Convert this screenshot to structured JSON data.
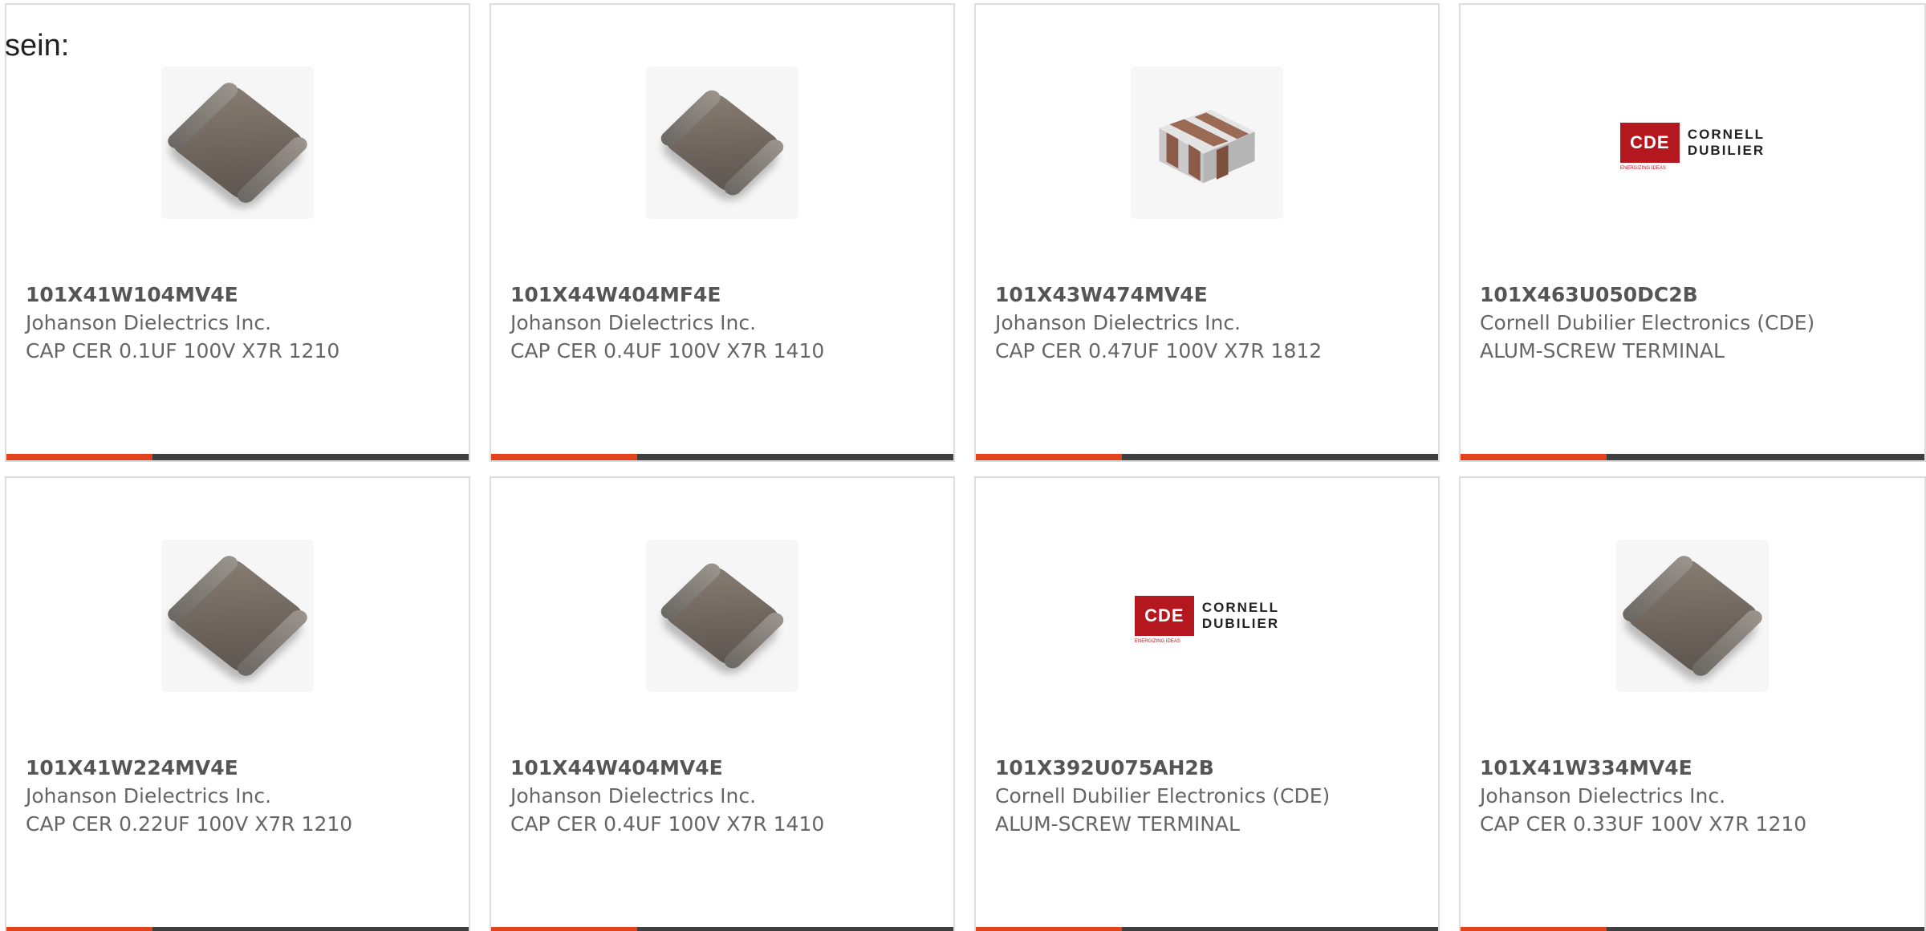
{
  "intro_text": "sein:",
  "products": [
    {
      "part_number": "101X41W104MV4E",
      "manufacturer": "Johanson Dielectrics Inc.",
      "description": "CAP CER 0.1UF 100V X7R 1210",
      "image": "mlcc-chip-image"
    },
    {
      "part_number": "101X44W404MF4E",
      "manufacturer": "Johanson Dielectrics Inc.",
      "description": "CAP CER 0.4UF 100V X7R 1410",
      "image": "mlcc-chip-image"
    },
    {
      "part_number": "101X43W474MV4E",
      "manufacturer": "Johanson Dielectrics Inc.",
      "description": "CAP CER 0.47UF 100V X7R 1812",
      "image": "mlcc-block-image"
    },
    {
      "part_number": "101X463U050DC2B",
      "manufacturer": "Cornell Dubilier Electronics (CDE)",
      "description": "ALUM-SCREW TERMINAL",
      "image": "cde-logo-image"
    },
    {
      "part_number": "101X41W224MV4E",
      "manufacturer": "Johanson Dielectrics Inc.",
      "description": "CAP CER 0.22UF 100V X7R 1210",
      "image": "mlcc-chip-image"
    },
    {
      "part_number": "101X44W404MV4E",
      "manufacturer": "Johanson Dielectrics Inc.",
      "description": "CAP CER 0.4UF 100V X7R 1410",
      "image": "mlcc-chip-image"
    },
    {
      "part_number": "101X392U075AH2B",
      "manufacturer": "Cornell Dubilier Electronics (CDE)",
      "description": "ALUM-SCREW TERMINAL",
      "image": "cde-logo-image"
    },
    {
      "part_number": "101X41W334MV4E",
      "manufacturer": "Johanson Dielectrics Inc.",
      "description": "CAP CER 0.33UF 100V X7R 1210",
      "image": "mlcc-chip-image"
    }
  ],
  "logo": {
    "mark": "CDE",
    "tagline": "ENERGIZING IDEAS",
    "line1": "CORNELL",
    "line2": "DUBILIER"
  },
  "colors": {
    "accent": "#e2431a",
    "bar": "#3f3f3f",
    "logo_red": "#b4171d"
  }
}
